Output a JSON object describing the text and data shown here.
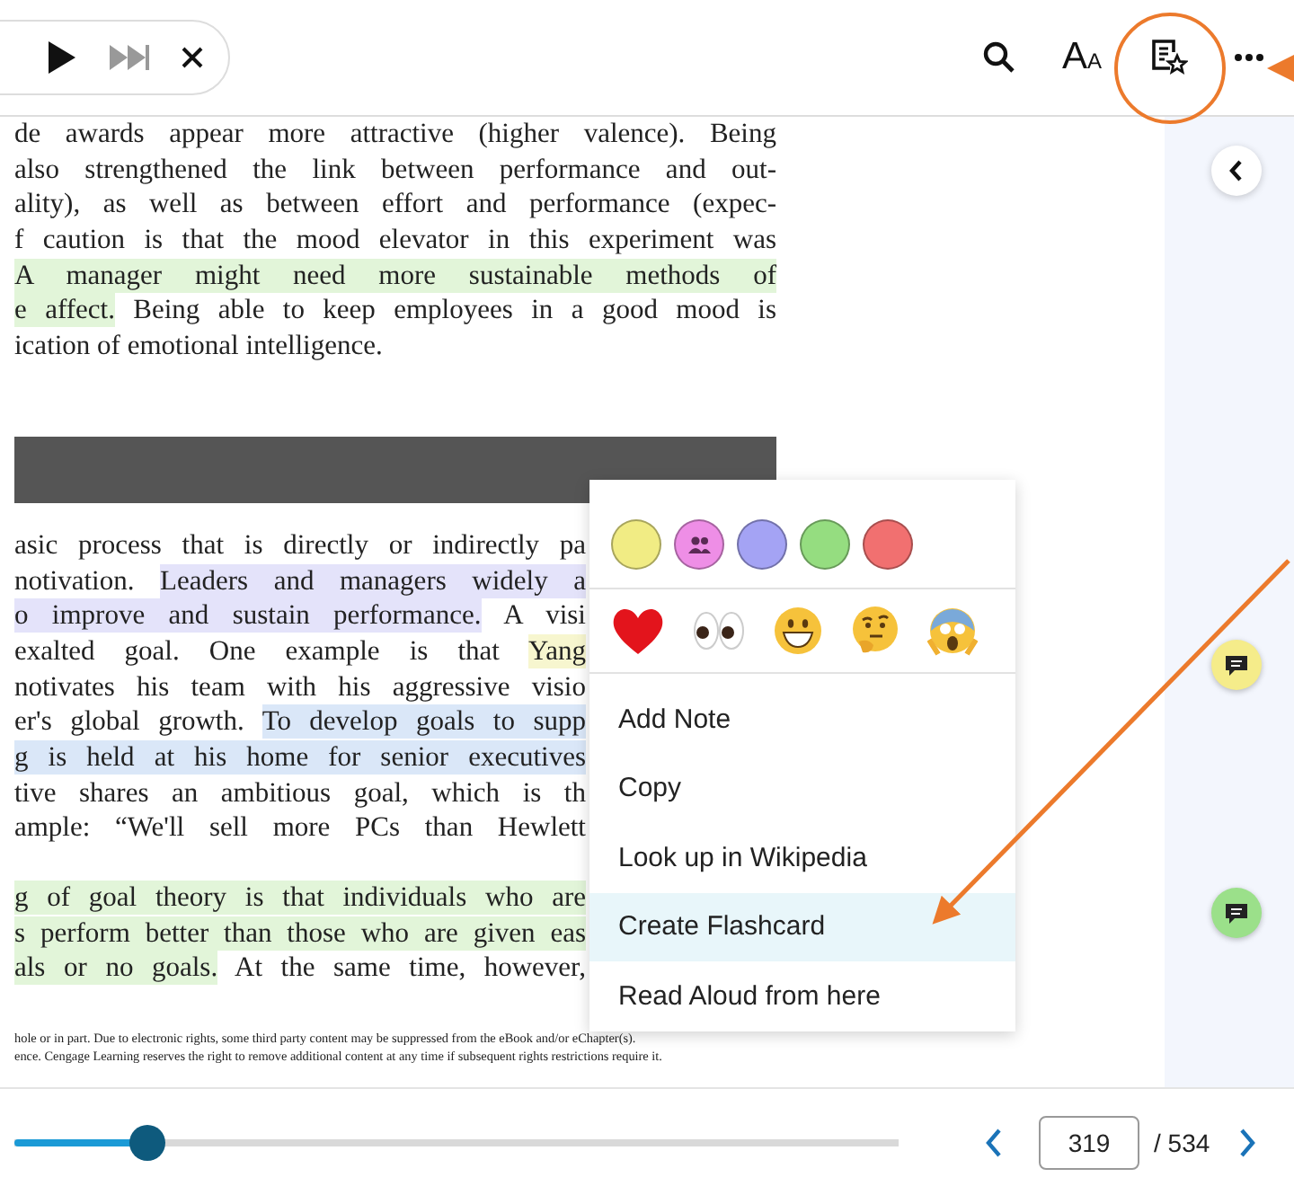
{
  "player": {
    "controls": [
      {
        "kind": "play"
      },
      {
        "kind": "skip"
      },
      {
        "kind": "close"
      }
    ]
  },
  "toolbar": {
    "font_button": {
      "large": "A",
      "small": "A"
    },
    "items": [
      {
        "kind": "search"
      },
      {
        "kind": "font"
      },
      {
        "kind": "flashcards"
      },
      {
        "kind": "more"
      }
    ]
  },
  "page": {
    "blocks": [
      {
        "kind": "paragraph",
        "lines": [
          [
            {
              "text": "de awards appear more attractive (higher valence). Being"
            }
          ],
          [
            {
              "text": "also strengthened the link between performance and out-"
            }
          ],
          [
            {
              "text": "ality), as well as between effort and performance (expec-"
            }
          ],
          [
            {
              "text": "f caution is that the mood elevator in this experiment was"
            }
          ],
          [
            {
              "text": "A manager might need more sustainable methods of",
              "color": "#e2f5d9"
            }
          ],
          [
            {
              "text": "e affect.",
              "color": "#e2f5d9"
            },
            {
              "text": " Being able to keep employees in a good mood is"
            }
          ],
          [
            {
              "text": "ication of emotional intelligence."
            }
          ]
        ]
      },
      {
        "kind": "banner"
      },
      {
        "kind": "column",
        "lines": [
          [
            {
              "text": "asic process that is directly or indirectly pa"
            }
          ],
          [
            {
              "text": "notivation. "
            },
            {
              "text": "Leaders and managers widely a",
              "color": "#e4e3fa"
            }
          ],
          [
            {
              "text": "o improve and sustain performance.",
              "color": "#e4e3fa"
            },
            {
              "text": " A visi"
            }
          ],
          [
            {
              "text": "exalted goal. One example is that "
            },
            {
              "text": "Yang",
              "color": "#f7f6cf"
            }
          ],
          [
            {
              "text": "notivates his team with his aggressive visio"
            }
          ],
          [
            {
              "text": "er's global growth. "
            },
            {
              "text": "To develop goals to supp",
              "color": "#dae7f8"
            }
          ],
          [
            {
              "text": "g is held at his home for senior executives",
              "color": "#dae7f8"
            }
          ],
          [
            {
              "text": "tive shares an ambitious goal, which is th"
            }
          ],
          [
            {
              "text": "ample: “We'll sell more PCs than Hewlett"
            }
          ]
        ]
      },
      {
        "kind": "column",
        "lines": [
          [
            {
              "text": "g of goal theory is that individuals who are",
              "color": "#e2f5d9"
            }
          ],
          [
            {
              "text": "s perform better than those who are given eas",
              "color": "#e2f5d9"
            }
          ],
          [
            {
              "text": "als or no goals.",
              "color": "#e2f5d9"
            },
            {
              "text": " At the same time, however,"
            }
          ]
        ]
      }
    ],
    "footer": [
      "hole or in part. Due to electronic rights, some third party content may be suppressed from the eBook and/or eChapter(s).",
      "ence. Cengage Learning reserves the right to remove additional content at any time if subsequent rights restrictions require it."
    ]
  },
  "margin_notes": [
    {
      "color": "#f5ec8a"
    },
    {
      "color": "#9be08a"
    }
  ],
  "context_menu": {
    "swatches": [
      {
        "color": "#f1ec84",
        "shared": false
      },
      {
        "color": "#ee8ee6",
        "shared": true
      },
      {
        "color": "#a4a3f4",
        "shared": false
      },
      {
        "color": "#95dd80",
        "shared": false
      },
      {
        "color": "#f17070",
        "shared": false
      }
    ],
    "reactions": [
      {
        "kind": "heart"
      },
      {
        "kind": "eyes"
      },
      {
        "kind": "grin"
      },
      {
        "kind": "thinking"
      },
      {
        "kind": "scream"
      }
    ],
    "items": [
      {
        "label": "Add Note",
        "selected": false
      },
      {
        "label": "Copy",
        "selected": false
      },
      {
        "label": "Look up in Wikipedia",
        "selected": false
      },
      {
        "label": "Create Flashcard",
        "selected": true
      },
      {
        "label": "Read Aloud from here",
        "selected": false
      }
    ]
  },
  "navigation": {
    "level": 0.15,
    "page": "319",
    "total": "/ 534"
  }
}
